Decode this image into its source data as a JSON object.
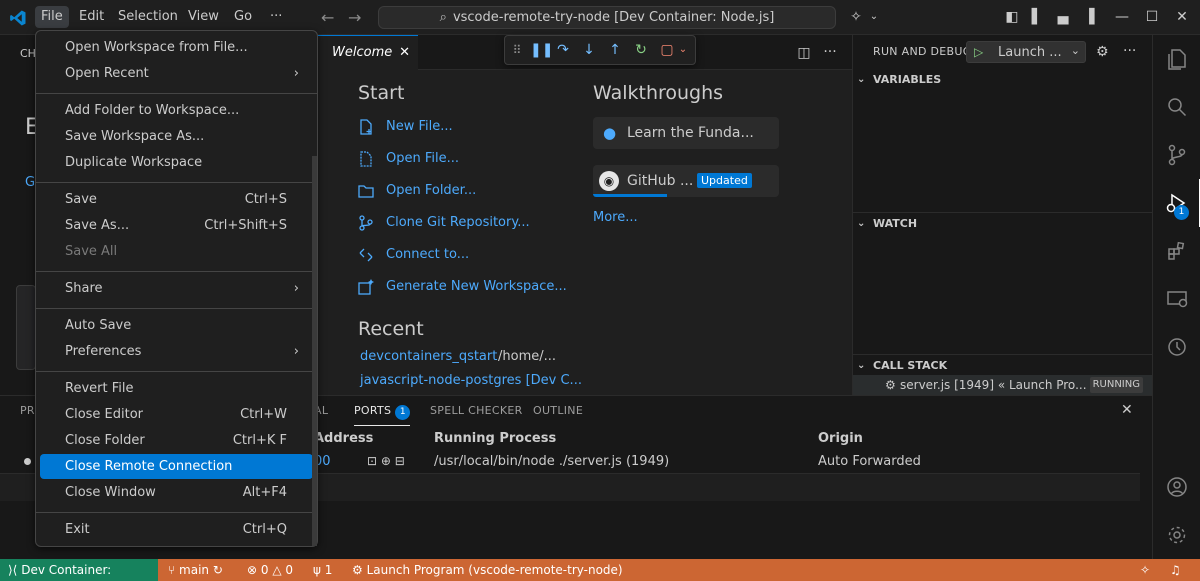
{
  "titlebar": {
    "menus": [
      "File",
      "Edit",
      "Selection",
      "View",
      "Go",
      "···"
    ],
    "command_center": "vscode-remote-try-node [Dev Container: Node.js]"
  },
  "file_menu": {
    "items": [
      {
        "label": "Open Workspace from File...",
        "kb": "",
        "submenu": false
      },
      {
        "label": "Open Recent",
        "kb": "",
        "submenu": true
      },
      {
        "label": "Add Folder to Workspace...",
        "kb": "",
        "submenu": false
      },
      {
        "label": "Save Workspace As...",
        "kb": "",
        "submenu": false
      },
      {
        "label": "Duplicate Workspace",
        "kb": "",
        "submenu": false
      },
      {
        "label": "Save",
        "kb": "Ctrl+S",
        "submenu": false
      },
      {
        "label": "Save As...",
        "kb": "Ctrl+Shift+S",
        "submenu": false
      },
      {
        "label": "Save All",
        "kb": "",
        "submenu": false
      },
      {
        "label": "Share",
        "kb": "",
        "submenu": true
      },
      {
        "label": "Auto Save",
        "kb": "",
        "submenu": false
      },
      {
        "label": "Preferences",
        "kb": "",
        "submenu": true
      },
      {
        "label": "Revert File",
        "kb": "",
        "submenu": false
      },
      {
        "label": "Close Editor",
        "kb": "Ctrl+W",
        "submenu": false
      },
      {
        "label": "Close Folder",
        "kb": "Ctrl+K F",
        "submenu": false
      },
      {
        "label": "Close Remote Connection",
        "kb": "",
        "submenu": false
      },
      {
        "label": "Close Window",
        "kb": "Alt+F4",
        "submenu": false
      },
      {
        "label": "Exit",
        "kb": "Ctrl+Q",
        "submenu": false
      }
    ]
  },
  "editor": {
    "tab_label": "Welcome",
    "start_title": "Start",
    "start_links": [
      "New File...",
      "Open File...",
      "Open Folder...",
      "Clone Git Repository...",
      "Connect to...",
      "Generate New Workspace..."
    ],
    "walkthroughs_title": "Walkthroughs",
    "walkthroughs": [
      {
        "label": "Learn the Funda..."
      },
      {
        "label": "GitHub ...",
        "badge": "Updated"
      }
    ],
    "more_label": "More...",
    "recent_title": "Recent",
    "recent": [
      {
        "name": "devcontainers_qstart",
        "path": "/home/..."
      },
      {
        "name": "javascript-node-postgres [Dev C...",
        "path": ""
      }
    ]
  },
  "debug_panel": {
    "title": "RUN AND DEBUG",
    "launch_config": "Launch ...",
    "sections": [
      "VARIABLES",
      "WATCH",
      "CALL STACK"
    ],
    "callstack_item": "server.js [1949] « Launch Pro...",
    "callstack_state": "RUNNING"
  },
  "panel": {
    "tabs": [
      "PR",
      "AL",
      "PORTS",
      "SPELL CHECKER",
      "OUTLINE"
    ],
    "ports_badge": "1",
    "columns": [
      "Address",
      "Running Process",
      "Origin"
    ],
    "row": {
      "address": "00",
      "process": "/usr/local/bin/node ./server.js (1949)",
      "origin": "Auto Forwarded"
    }
  },
  "activity_badge": "1",
  "statusbar": {
    "remote": "Dev Container: Node.js",
    "branch": "main",
    "problems": "0",
    "warnings": "0",
    "ports": "1",
    "launch": "Launch Program (vscode-remote-try-node)"
  },
  "colors": {
    "accent": "#0078d4",
    "statusbar": "#cc6633",
    "remote": "#16825d",
    "link": "#4daafc"
  }
}
